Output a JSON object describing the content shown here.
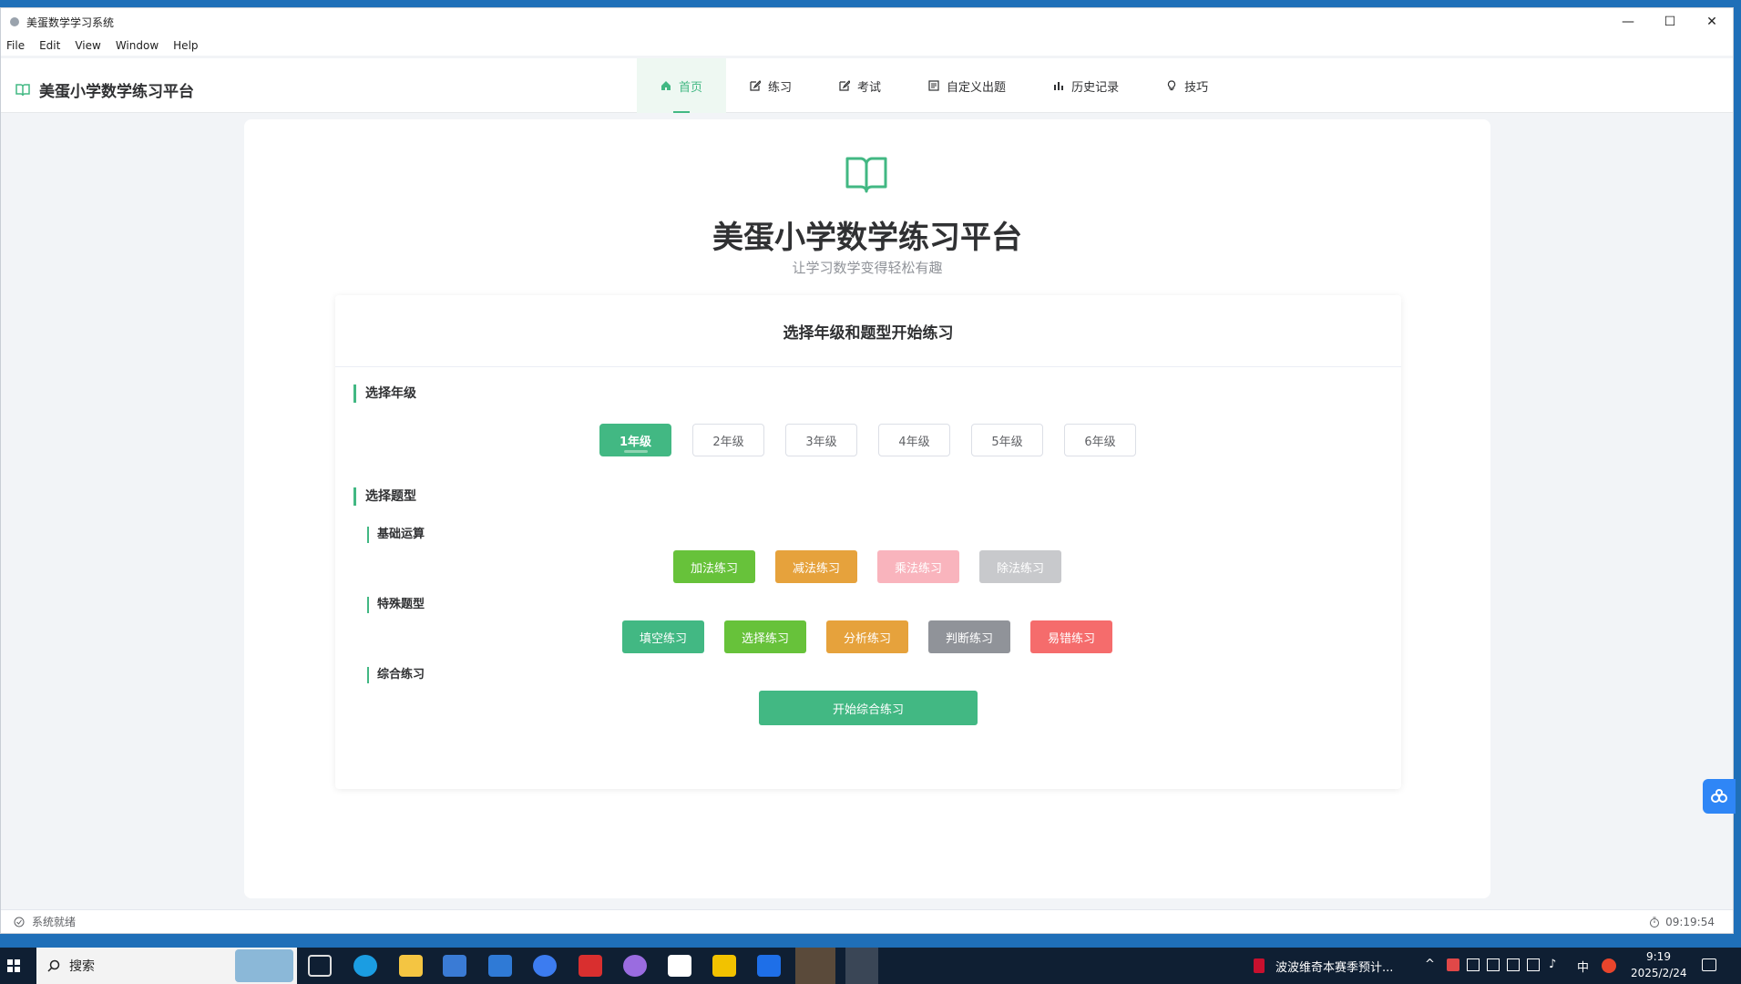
{
  "window": {
    "title": "美蛋数学学习系统"
  },
  "menu": [
    "File",
    "Edit",
    "View",
    "Window",
    "Help"
  ],
  "brand": "美蛋小学数学练习平台",
  "nav": [
    {
      "label": "首页",
      "icon": "home-icon"
    },
    {
      "label": "练习",
      "icon": "edit-icon"
    },
    {
      "label": "考试",
      "icon": "edit-icon"
    },
    {
      "label": "自定义出题",
      "icon": "document-icon"
    },
    {
      "label": "历史记录",
      "icon": "bar-chart-icon"
    },
    {
      "label": "技巧",
      "icon": "bulb-icon"
    }
  ],
  "hero": {
    "title": "美蛋小学数学练习平台",
    "subtitle": "让学习数学变得轻松有趣"
  },
  "panel": {
    "title": "选择年级和题型开始练习",
    "grade_label": "选择年级",
    "grades": [
      "1年级",
      "2年级",
      "3年级",
      "4年级",
      "5年级",
      "6年级"
    ],
    "type_label": "选择题型",
    "basic_label": "基础运算",
    "basic": [
      "加法练习",
      "减法练习",
      "乘法练习",
      "除法练习"
    ],
    "special_label": "特殊题型",
    "special": [
      "填空练习",
      "选择练习",
      "分析练习",
      "判断练习",
      "易错练习"
    ],
    "combo_label": "综合练习",
    "combo_button": "开始综合练习"
  },
  "status": {
    "left": "系统就绪",
    "right": "09:19:54"
  },
  "colors": {
    "primary": "#42b883",
    "green": "#67c23a",
    "orange": "#e6a23c",
    "pink": "#f9b4bd",
    "gray_light": "#c8c9cc",
    "gray": "#909399",
    "red": "#f56c6c"
  },
  "taskbar": {
    "search": "搜索",
    "news": "波波维奇本赛季预计...",
    "ime": "中",
    "time": "9:19",
    "date": "2025/2/24"
  }
}
